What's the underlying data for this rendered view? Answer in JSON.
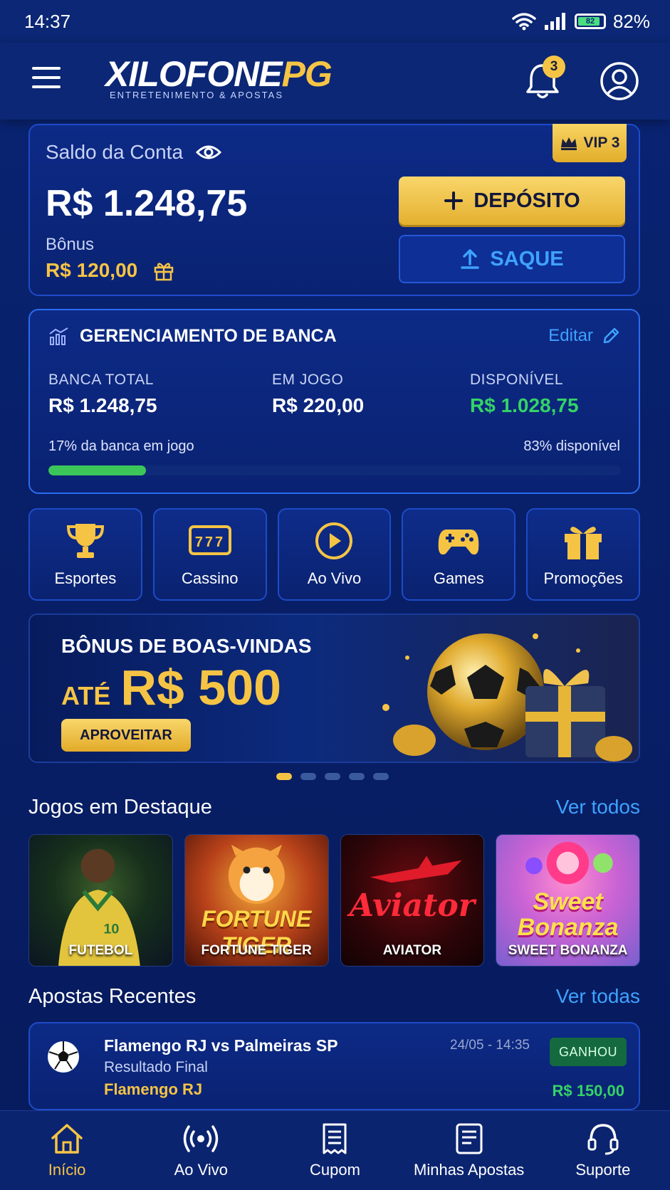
{
  "status_bar": {
    "time": "14:37",
    "battery": "82%"
  },
  "header": {
    "logo_main": "XILOFONE",
    "logo_pg": "PG",
    "logo_tagline": "ENTRETENIMENTO & APOSTAS",
    "notification_count": "3"
  },
  "account": {
    "balance_label": "Saldo da Conta",
    "balance_value": "R$ 1.248,75",
    "bonus_label": "Bônus",
    "bonus_value": "R$ 120,00",
    "vip_label": "VIP 3",
    "deposit_label": "DEPÓSITO",
    "withdraw_label": "SAQUE"
  },
  "bankroll": {
    "title": "GERENCIAMENTO DE BANCA",
    "edit_label": "Editar",
    "total_label": "BANCA TOTAL",
    "total_value": "R$ 1.248,75",
    "in_play_label": "EM JOGO",
    "in_play_value": "R$ 220,00",
    "available_label": "DISPONÍVEL",
    "available_value": "R$ 1.028,75",
    "in_play_note": "17% da banca em jogo",
    "available_note": "83% disponível",
    "in_play_percent": 17
  },
  "categories": [
    {
      "label": "Esportes",
      "icon": "trophy-icon"
    },
    {
      "label": "Cassino",
      "icon": "slot-machine-icon"
    },
    {
      "label": "Ao Vivo",
      "icon": "play-circle-icon"
    },
    {
      "label": "Games",
      "icon": "gamepad-icon"
    },
    {
      "label": "Promoções",
      "icon": "gift-icon"
    }
  ],
  "banner": {
    "title": "BÔNUS DE BOAS-VINDAS",
    "amount_prefix": "ATÉ",
    "amount": "R$ 500",
    "cta": "APROVEITAR",
    "slides": 5,
    "active_slide": 1
  },
  "featured": {
    "title": "Jogos em Destaque",
    "link": "Ver todos",
    "games": [
      {
        "label": "FUTEBOL"
      },
      {
        "label": "FORTUNE TIGER",
        "art": "FORTUNE TIGER"
      },
      {
        "label": "AVIATOR",
        "art": "Aviator"
      },
      {
        "label": "SWEET BONANZA",
        "art": "Sweet Bonanza"
      }
    ]
  },
  "recent_bets": {
    "title": "Apostas Recentes",
    "link": "Ver todas",
    "items": [
      {
        "match": "Flamengo RJ vs Palmeiras SP",
        "market": "Resultado Final",
        "pick": "Flamengo RJ",
        "date": "24/05 - 14:35",
        "status": "GANHOU",
        "amount": "R$ 150,00"
      }
    ]
  },
  "bottom_nav": [
    {
      "label": "Início",
      "icon": "home-icon",
      "active": true
    },
    {
      "label": "Ao Vivo",
      "icon": "live-broadcast-icon"
    },
    {
      "label": "Cupom",
      "icon": "coupon-icon"
    },
    {
      "label": "Minhas Apostas",
      "icon": "my-bets-icon"
    },
    {
      "label": "Suporte",
      "icon": "headset-icon"
    }
  ],
  "colors": {
    "background": "#08206a",
    "accent_gold": "#f6c445",
    "link_blue": "#3ea2ff",
    "success_green": "#34d366"
  }
}
